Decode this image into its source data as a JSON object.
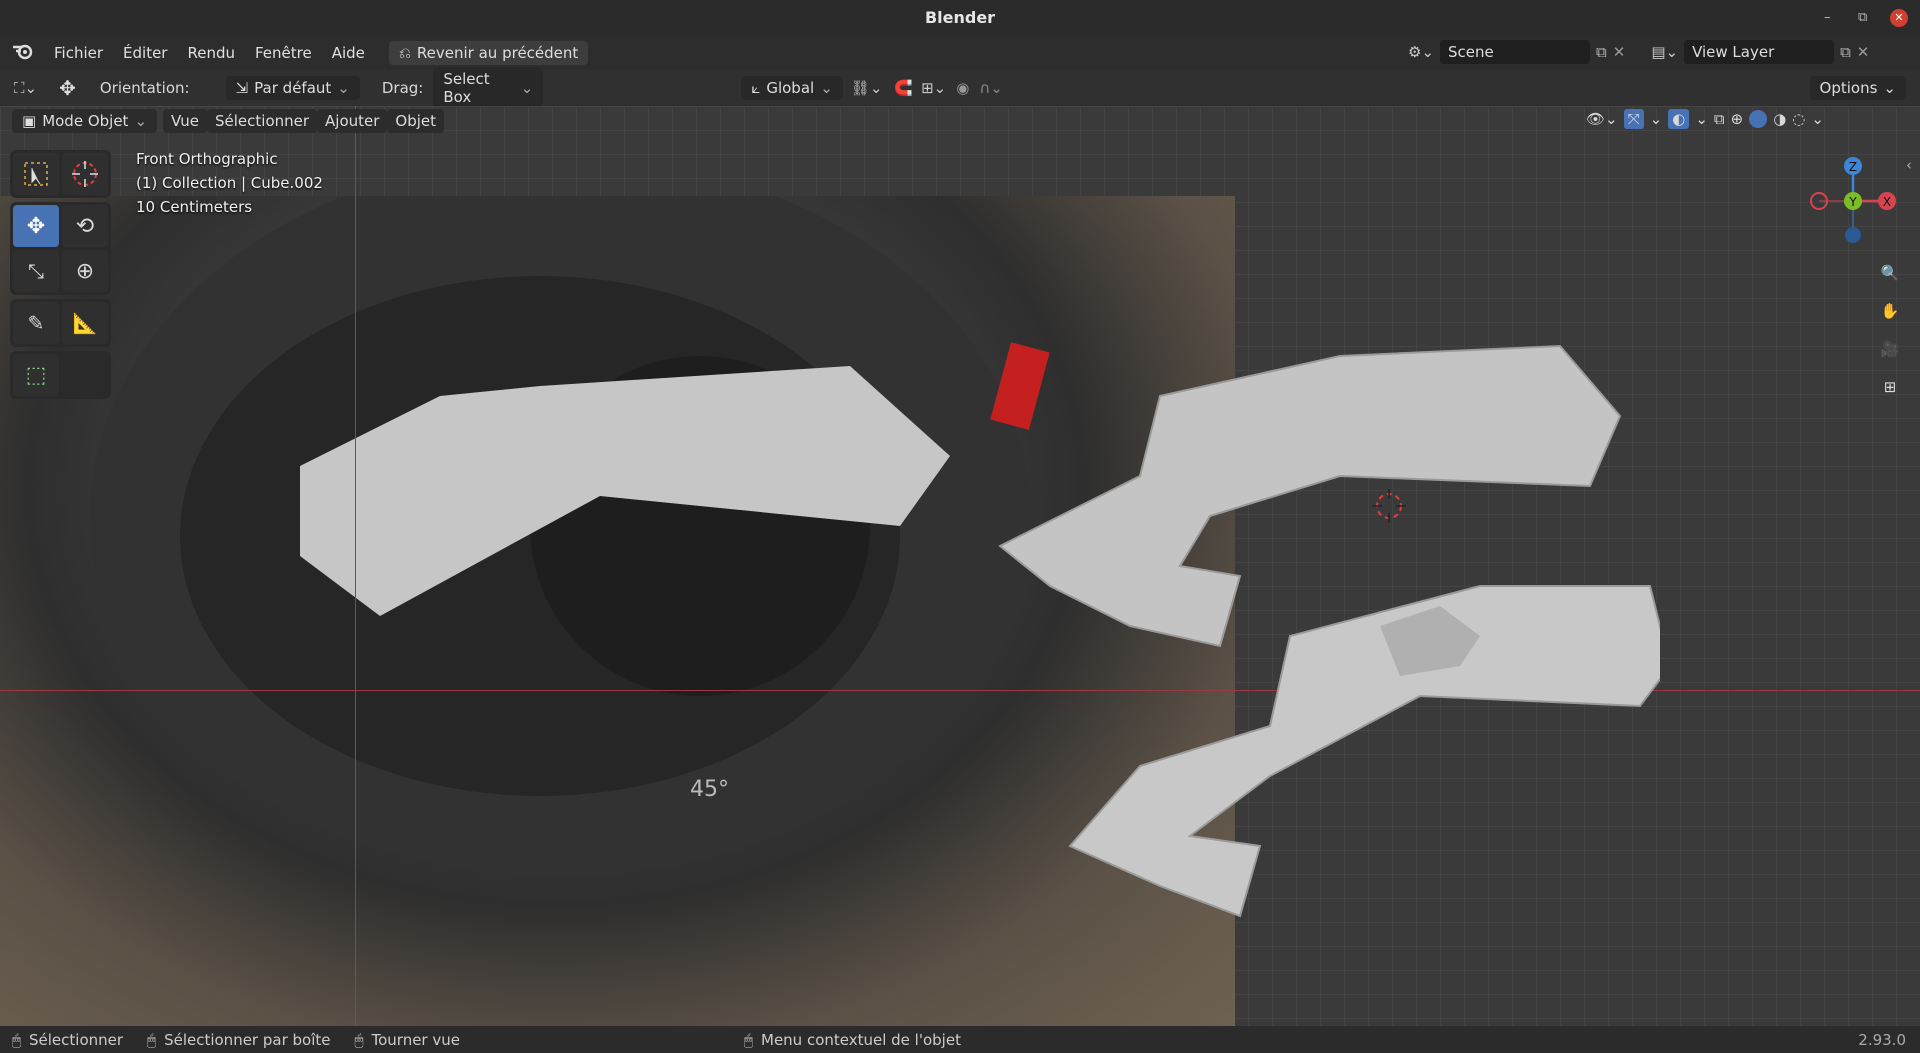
{
  "window": {
    "title": "Blender",
    "minimize": "–",
    "maximize": "⧉",
    "close": "✕"
  },
  "menubar": {
    "items": [
      "Fichier",
      "Éditer",
      "Rendu",
      "Fenêtre",
      "Aide"
    ],
    "revert_label": "Revenir au précédent",
    "scene_label": "Scene",
    "view_layer_label": "View Layer"
  },
  "tool_header": {
    "orientation_label": "Orientation:",
    "orientation_value": "Par défaut",
    "drag_label": "Drag:",
    "drag_value": "Select Box",
    "transform_orientation": "Global",
    "options_label": "Options"
  },
  "view_header": {
    "mode": "Mode Objet",
    "menus": [
      "Vue",
      "Sélectionner",
      "Ajouter",
      "Objet"
    ]
  },
  "viewport_overlay": {
    "view_name": "Front Orthographic",
    "collection": "(1) Collection | Cube.002",
    "scale": "10 Centimeters"
  },
  "gizmo": {
    "z": "Z",
    "y": "Y",
    "x": "X"
  },
  "reference_image": {
    "marking": "45°"
  },
  "statusbar": {
    "select": "Sélectionner",
    "box_select": "Sélectionner par boîte",
    "rotate_view": "Tourner vue",
    "context_menu": "Menu contextuel de l'objet",
    "version": "2.93.0"
  },
  "colors": {
    "accent": "#4772b3",
    "x_axis": "#d9434f",
    "y_axis": "#7bbd27",
    "z_axis": "#3b86d6",
    "cursor": "#e63c3c"
  }
}
